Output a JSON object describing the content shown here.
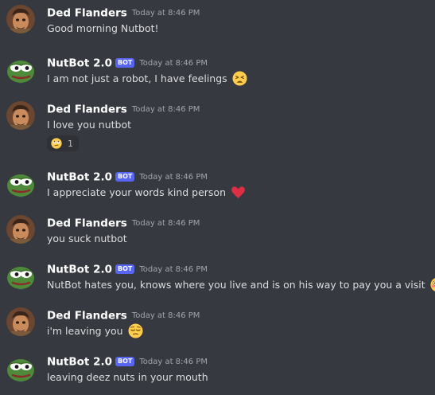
{
  "messages": [
    {
      "author": "Ded Flanders",
      "avatar": "ned-avatar",
      "bot": false,
      "timestamp": "Today at 8:46 PM",
      "text": "Good morning Nutbot!",
      "emoji": null
    },
    {
      "author": "NutBot 2.0",
      "avatar": "pepe-avatar",
      "bot": true,
      "bot_label": "BOT",
      "timestamp": "Today at 8:46 PM",
      "text": "I am not just a robot, I have feelings",
      "emoji": "weary-face-emoji"
    },
    {
      "author": "Ded Flanders",
      "avatar": "ned-avatar",
      "bot": false,
      "timestamp": "Today at 8:46 PM",
      "text": "I love you nutbot",
      "emoji": null,
      "reaction": {
        "emoji": "rolling-eyes-emoji",
        "count": "1"
      }
    },
    {
      "author": "NutBot 2.0",
      "avatar": "pepe-avatar",
      "bot": true,
      "bot_label": "BOT",
      "timestamp": "Today at 8:46 PM",
      "text": "I appreciate your words kind person",
      "emoji": "red-heart-emoji"
    },
    {
      "author": "Ded Flanders",
      "avatar": "ned-avatar",
      "bot": false,
      "timestamp": "Today at 8:46 PM",
      "text": "you suck nutbot",
      "emoji": null
    },
    {
      "author": "NutBot 2.0",
      "avatar": "pepe-avatar",
      "bot": true,
      "bot_label": "BOT",
      "timestamp": "Today at 8:46 PM",
      "text": "NutBot hates you, knows where you live and is on his way to pay you a visit",
      "emoji": "flushed-face-emoji"
    },
    {
      "author": "Ded Flanders",
      "avatar": "ned-avatar",
      "bot": false,
      "timestamp": "Today at 8:46 PM",
      "text": "i'm leaving you",
      "emoji": "relieved-face-emoji"
    },
    {
      "author": "NutBot 2.0",
      "avatar": "pepe-avatar",
      "bot": true,
      "bot_label": "BOT",
      "timestamp": "Today at 8:46 PM",
      "text": "leaving deez nuts in your mouth",
      "emoji": null
    }
  ],
  "colors": {
    "background": "#36393f",
    "username": "#ffffff",
    "message_text": "#dcddde",
    "timestamp": "#a3a6aa",
    "bot_tag": "#5865f2",
    "reaction_bg": "#2f3136"
  }
}
